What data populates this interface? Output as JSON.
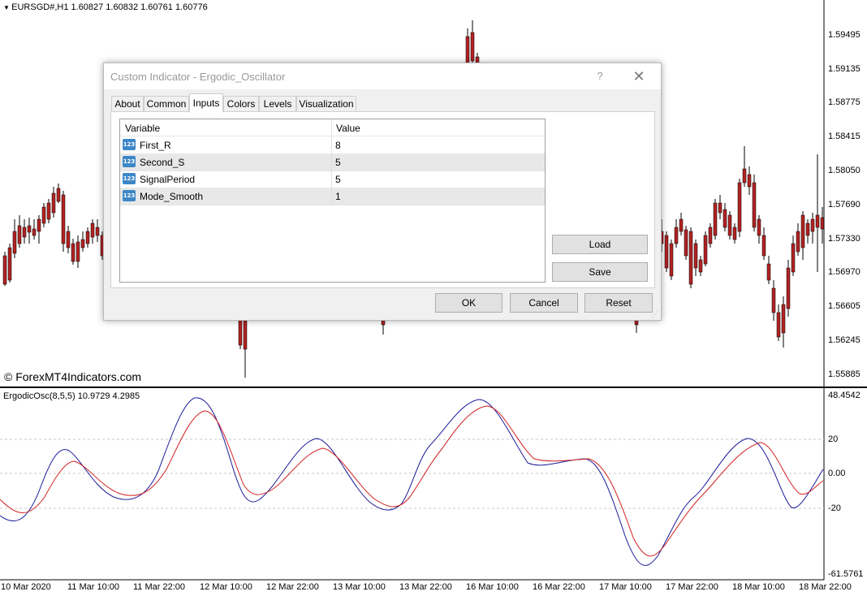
{
  "chart": {
    "symbol_info": "EURSGD#,H1  1.60827 1.60832 1.60761 1.60776",
    "watermark": "© ForexMT4Indicators.com",
    "price_scale": [
      "1.59495",
      "1.59135",
      "1.58775",
      "1.58415",
      "1.58050",
      "1.57690",
      "1.57330",
      "1.56970",
      "1.56605",
      "1.56245",
      "1.55885"
    ],
    "oscillator_info": "ErgodicOsc(8,5,5) 10.9729 4.2985",
    "osc_scale": [
      "48.4542",
      "20",
      "0.00",
      "-20",
      "-61.5761"
    ],
    "time_labels": [
      "10 Mar 2020",
      "11 Mar 10:00",
      "11 Mar 22:00",
      "12 Mar 10:00",
      "12 Mar 22:00",
      "13 Mar 10:00",
      "13 Mar 22:00",
      "16 Mar 10:00",
      "16 Mar 22:00",
      "17 Mar 10:00",
      "17 Mar 22:00",
      "18 Mar 10:00",
      "18 Mar 22:00"
    ],
    "colors": {
      "bull": "#3cb371",
      "bear": "#b22222",
      "main_line": "#1a1a9a",
      "signal_line": "#d22020",
      "level_line": "#c8c8c8"
    }
  },
  "dialog": {
    "title": "Custom Indicator - Ergodic_Oscillator",
    "help_label": "?",
    "close_icon": "✕",
    "tabs": [
      {
        "label": "About"
      },
      {
        "label": "Common"
      },
      {
        "label": "Inputs"
      },
      {
        "label": "Colors"
      },
      {
        "label": "Levels"
      },
      {
        "label": "Visualization"
      }
    ],
    "active_tab": "Inputs",
    "table": {
      "headers": [
        "Variable",
        "Value"
      ],
      "rows": [
        {
          "icon": "123",
          "name": "First_R",
          "value": "8"
        },
        {
          "icon": "123",
          "name": "Second_S",
          "value": "5"
        },
        {
          "icon": "123",
          "name": "SignalPeriod",
          "value": "5"
        },
        {
          "icon": "123",
          "name": "Mode_Smooth",
          "value": "1"
        }
      ]
    },
    "buttons": {
      "load": "Load",
      "save": "Save",
      "ok": "OK",
      "cancel": "Cancel",
      "reset": "Reset"
    }
  }
}
